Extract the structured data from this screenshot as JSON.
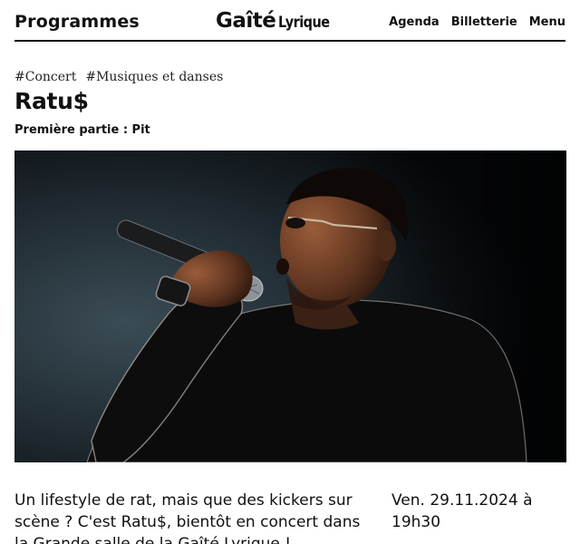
{
  "header": {
    "programmes_label": "Programmes",
    "logo_main": "Gaîté",
    "logo_sub": "Lyrique",
    "nav": [
      "Agenda",
      "Billetterie",
      "Menu"
    ]
  },
  "event": {
    "tags": [
      "#Concert",
      "#Musiques et danses"
    ],
    "title": "Ratu$",
    "support": "Première partie : Pit",
    "description": "Un lifestyle de rat, mais que des kickers sur scène ? C'est Ratu$, bientôt en concert dans la Grande salle de la Gaîté Lyrique !",
    "date": "Ven. 29.11.2024 à 19h30"
  },
  "colors": {
    "text": "#111111",
    "background": "#ffffff",
    "photo_background": "#0c0f12"
  }
}
